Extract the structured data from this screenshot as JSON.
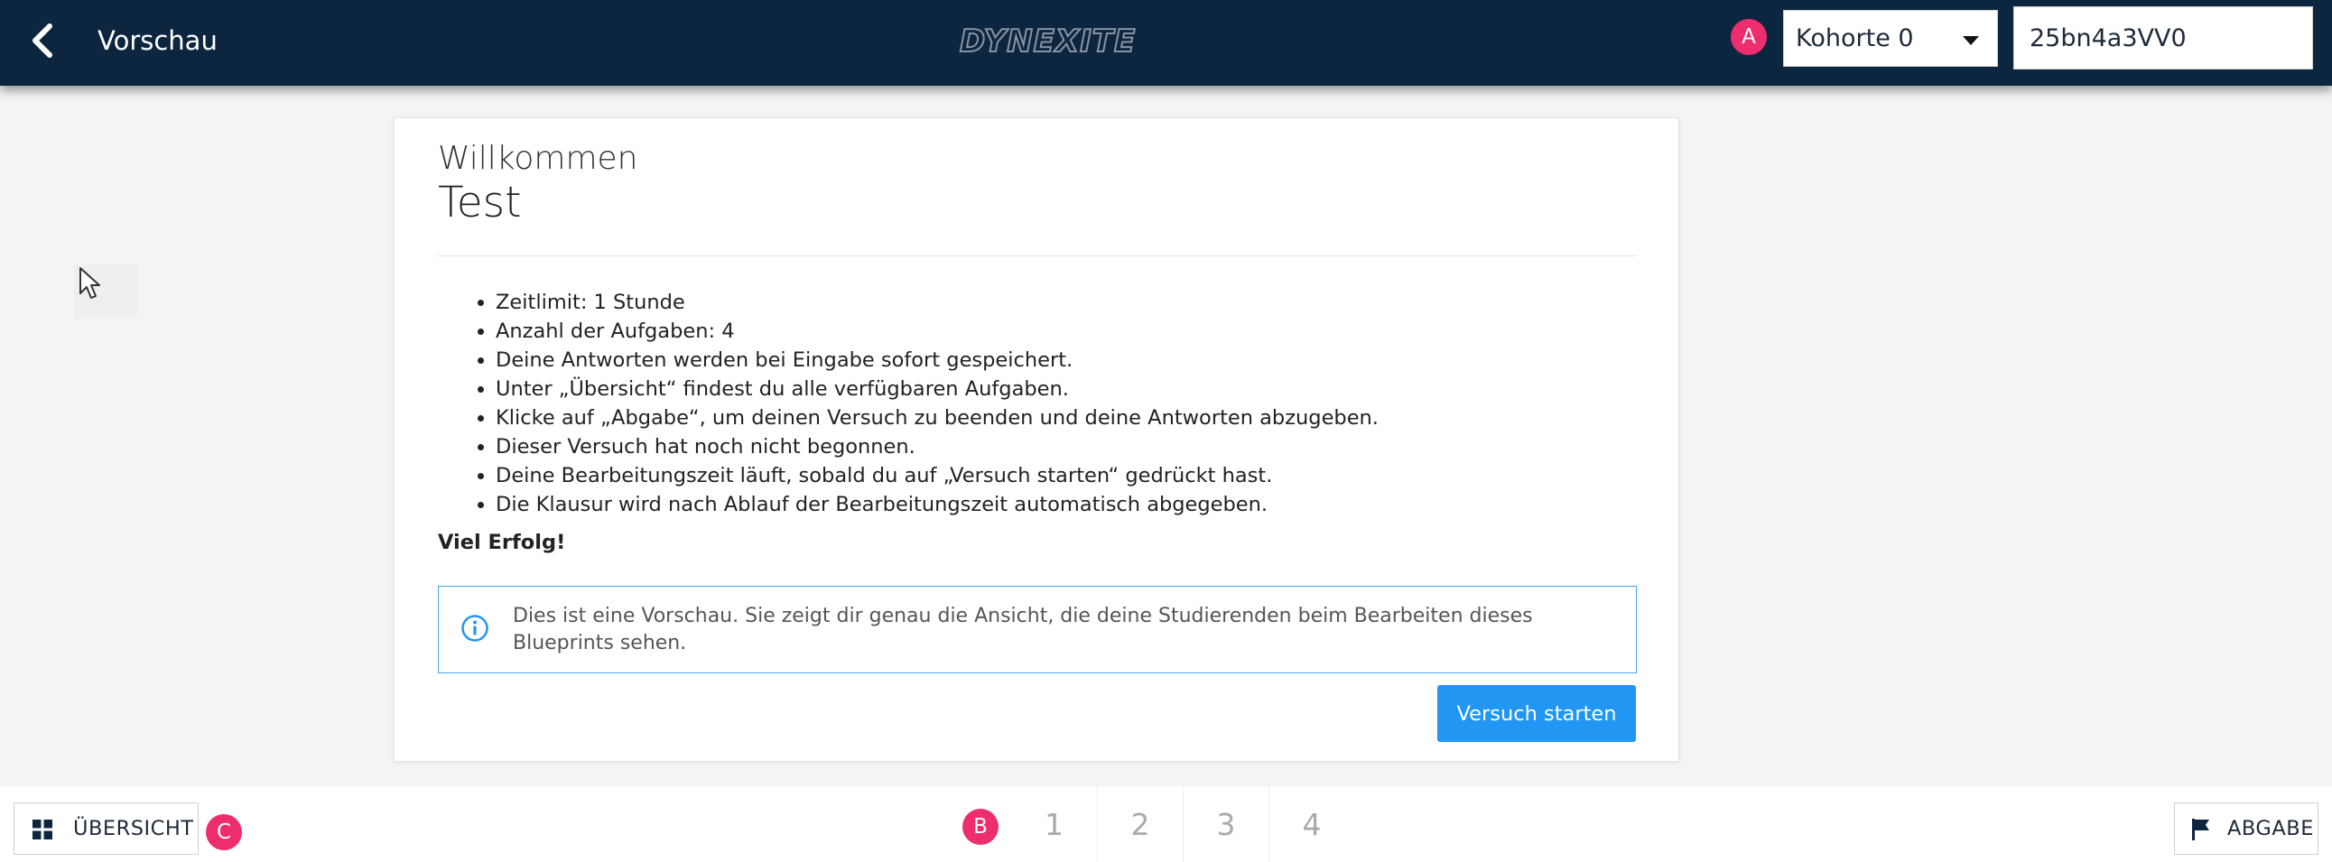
{
  "header": {
    "back_icon": "chevron-left-icon",
    "title": "Vorschau",
    "logo_text": "DYNEXITE",
    "annotation_a": "A",
    "cohort_select": {
      "selected": "Kohorte 0"
    },
    "code_input": {
      "value": "25bn4a3VV0"
    }
  },
  "main": {
    "welcome": "Willkommen",
    "test_title": "Test",
    "rules": [
      "Zeitlimit: 1 Stunde",
      "Anzahl der Aufgaben: 4",
      "Deine Antworten werden bei Eingabe sofort gespeichert.",
      "Unter „Übersicht“ findest du alle verfügbaren Aufgaben.",
      "Klicke auf „Abgabe“, um deinen Versuch zu beenden und deine Antworten abzugeben.",
      "Dieser Versuch hat noch nicht begonnen.",
      "Deine Bearbeitungszeit läuft, sobald du auf „Versuch starten“ gedrückt hast.",
      "Die Klausur wird nach Ablauf der Bearbeitungszeit automatisch abgegeben."
    ],
    "good_luck": "Viel Erfolg!",
    "info_box": {
      "icon": "info-icon",
      "text": "Dies ist eine Vorschau. Sie zeigt dir genau die Ansicht, die deine Studierenden beim Bearbeiten dieses Blueprints sehen."
    },
    "start_button": "Versuch starten"
  },
  "footer": {
    "overview_label": "ÜBERSICHT",
    "overview_icon": "grid-icon",
    "annotation_b": "B",
    "annotation_c": "C",
    "pages": [
      "1",
      "2",
      "3",
      "4"
    ],
    "submit_label": "ABGABE",
    "submit_icon": "flag-icon"
  },
  "colors": {
    "header_bg": "#0d2640",
    "primary": "#2196f3",
    "annotation": "#ee2d6e"
  }
}
